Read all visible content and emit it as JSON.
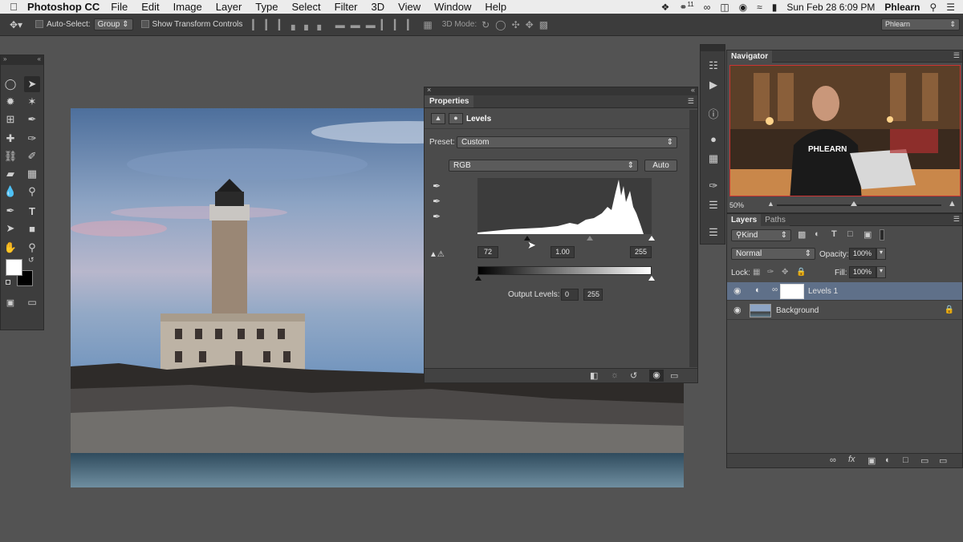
{
  "menubar": {
    "app_name": "Photoshop CC",
    "items": [
      "File",
      "Edit",
      "Image",
      "Layer",
      "Type",
      "Select",
      "Filter",
      "3D",
      "View",
      "Window",
      "Help"
    ],
    "status": {
      "badge": "11",
      "datetime": "Sun Feb 28  6:09 PM",
      "user": "Phlearn"
    }
  },
  "optionsbar": {
    "auto_select_label": "Auto-Select:",
    "auto_select_value": "Group",
    "transform_label": "Show Transform Controls",
    "mode_3d_label": "3D Mode:",
    "workspace": "Phlearn"
  },
  "properties": {
    "tab": "Properties",
    "adjustment": "Levels",
    "preset_label": "Preset:",
    "preset_value": "Custom",
    "channel": "RGB",
    "auto_label": "Auto",
    "input_black": "72",
    "input_gamma": "1.00",
    "input_white": "255",
    "output_label": "Output Levels:",
    "output_black": "0",
    "output_white": "255"
  },
  "navigator": {
    "tab": "Navigator",
    "zoom": "50%",
    "shirt_text": "PHLEARN"
  },
  "layers": {
    "tabs": [
      "Layers",
      "Paths"
    ],
    "filter": "Kind",
    "blend_mode": "Normal",
    "opacity_label": "Opacity:",
    "opacity_value": "100%",
    "lock_label": "Lock:",
    "fill_label": "Fill:",
    "fill_value": "100%",
    "items": [
      {
        "name": "Levels 1",
        "selected": true
      },
      {
        "name": "Background",
        "selected": false
      }
    ]
  },
  "colors": {
    "accent_selected": "#5f7089",
    "panel_bg": "#4b4b4b",
    "workspace_bg": "#535353"
  }
}
